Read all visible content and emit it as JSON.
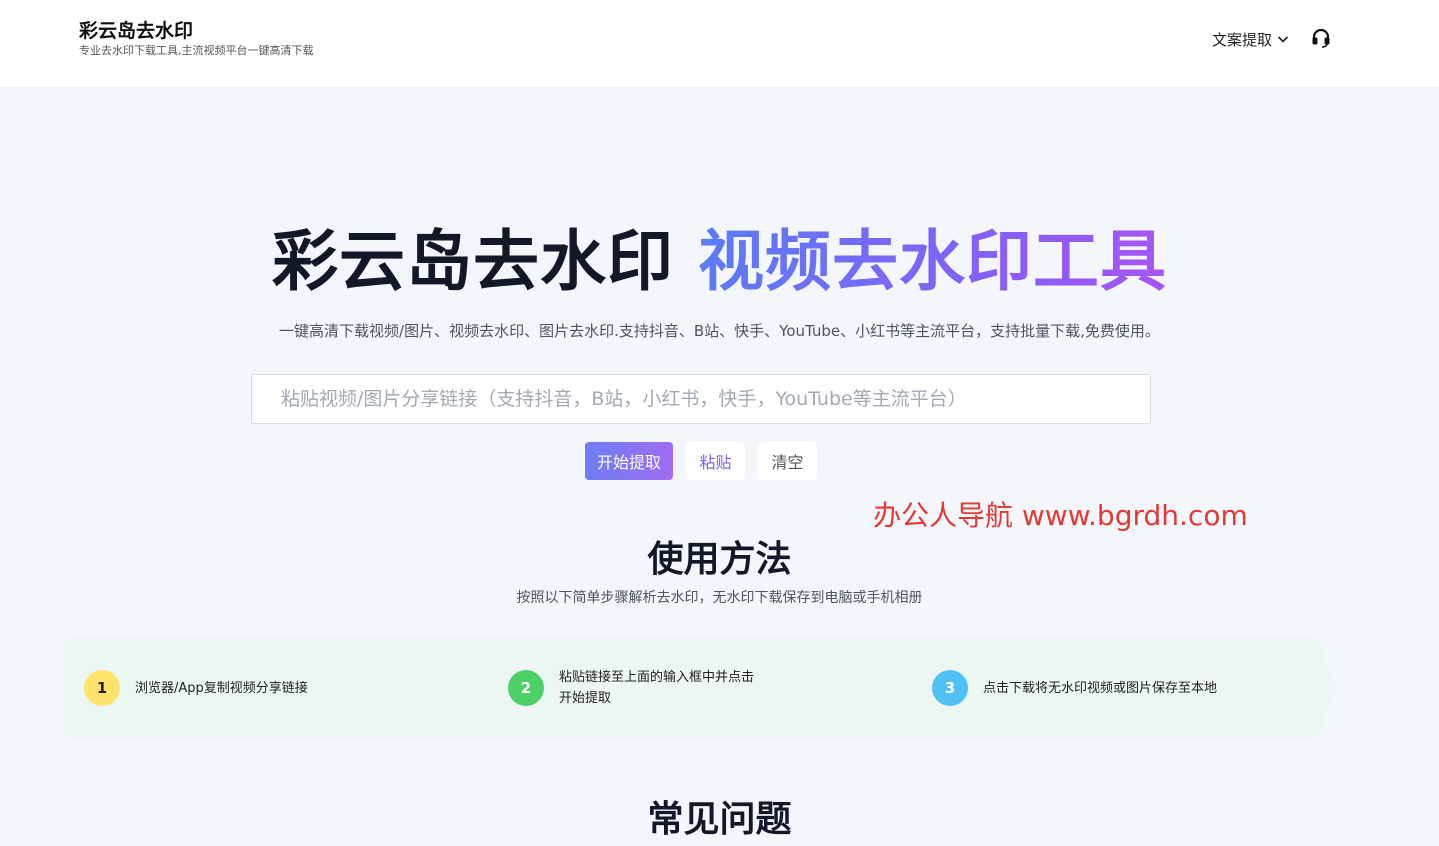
{
  "header": {
    "brand_title": "彩云岛去水印",
    "brand_subtitle": "专业去水印下载工具,主流视频平台一键高清下载",
    "nav_extract_label": "文案提取",
    "support_icon": "headset-icon"
  },
  "hero": {
    "title_dark": "彩云岛去水印",
    "title_gradient": "视频去水印工具",
    "description": "一键高清下载视频/图片、视频去水印、图片去水印.支持抖音、B站、快手、YouTube、小红书等主流平台，支持批量下载,免费使用。",
    "input_value": "",
    "input_placeholder": "粘贴视频/图片分享链接（支持抖音，B站，小红书，快手，YouTube等主流平台）",
    "start_button": "开始提取",
    "paste_button": "粘贴",
    "clear_button": "清空"
  },
  "watermark_text": "办公人导航 www.bgrdh.com",
  "usage": {
    "title": "使用方法",
    "subtitle": "按照以下简单步骤解析去水印，无水印下载保存到电脑或手机相册",
    "steps": [
      {
        "number": "1",
        "text": "浏览器/App复制视频分享链接"
      },
      {
        "number": "2",
        "text": "粘贴链接至上面的输入框中并点击开始提取"
      },
      {
        "number": "3",
        "text": "点击下载将无水印视频或图片保存至本地"
      }
    ]
  },
  "faq": {
    "title": "常见问题"
  },
  "colors": {
    "gradient_start": "#5b7cf6",
    "gradient_end": "#a855f7",
    "watermark": "#e53935",
    "step1": "#fde26b",
    "step2": "#4bd168",
    "step3": "#4fc1f4",
    "steps_bg": "#ecf6f3"
  }
}
